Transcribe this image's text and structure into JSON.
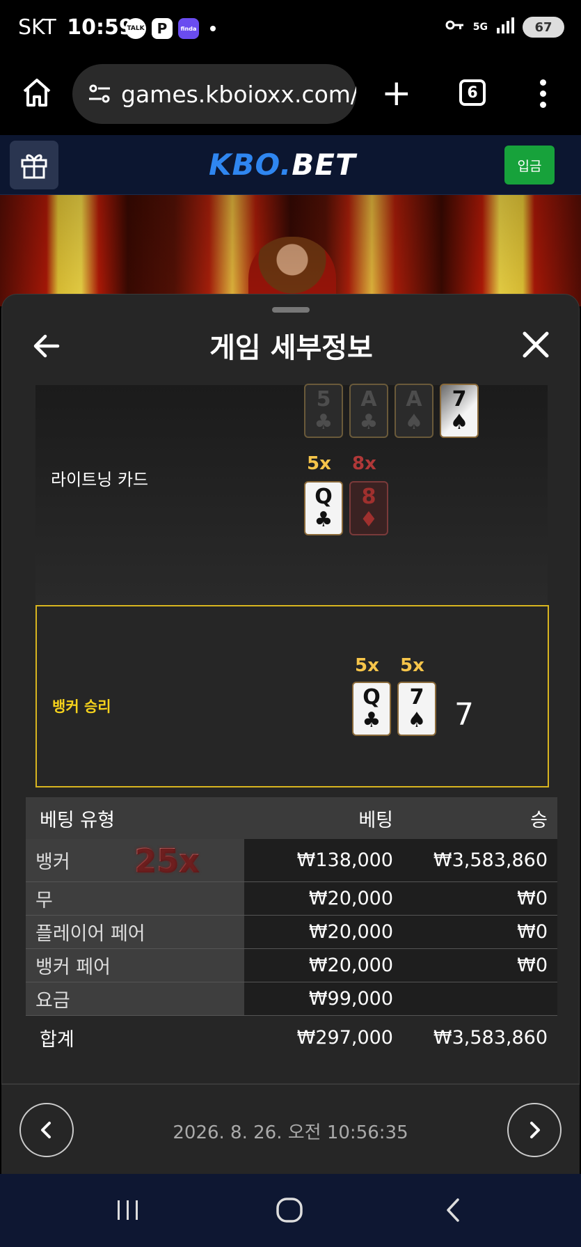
{
  "status_bar": {
    "carrier": "SKT",
    "time": "10:59",
    "apps": [
      "TALK",
      "P",
      "finda"
    ],
    "battery": "67",
    "network": "5G"
  },
  "browser": {
    "url": "games.kboioxx.com/",
    "tab_count": "6"
  },
  "site": {
    "logo_kbo": "KBO.",
    "logo_bet": "BET",
    "deposit_label": "입금"
  },
  "sheet": {
    "title": "게임 세부정보",
    "lightning_label": "라이트닝 카드",
    "top_cards": [
      {
        "rank": "5",
        "suit": "♣",
        "state": "dim"
      },
      {
        "rank": "A",
        "suit": "♣",
        "state": "dim"
      },
      {
        "rank": "A",
        "suit": "♠",
        "state": "dim"
      },
      {
        "rank": "7",
        "suit": "♠",
        "state": "lit"
      }
    ],
    "lightning_cards": [
      {
        "rank": "Q",
        "suit": "♣",
        "mult": "5x"
      },
      {
        "rank": "8",
        "suit": "♦",
        "mult": "8x"
      }
    ],
    "result_label": "뱅커 승리",
    "banker_cards": [
      {
        "rank": "Q",
        "suit": "♣",
        "mult": "5x"
      },
      {
        "rank": "7",
        "suit": "♠",
        "mult": "5x"
      }
    ],
    "banker_total": "7"
  },
  "bets": {
    "headers": {
      "type": "베팅 유형",
      "bet": "베팅",
      "win": "승"
    },
    "rows": [
      {
        "type": "뱅커",
        "mult": "25x",
        "bet": "₩138,000",
        "win": "₩3,583,860"
      },
      {
        "type": "무",
        "bet": "₩20,000",
        "win": "₩0"
      },
      {
        "type": "플레이어 페어",
        "bet": "₩20,000",
        "win": "₩0"
      },
      {
        "type": "뱅커 페어",
        "bet": "₩20,000",
        "win": "₩0"
      },
      {
        "type": "요금",
        "bet": "₩99,000",
        "win": ""
      }
    ],
    "total": {
      "type": "합계",
      "bet": "₩297,000",
      "win": "₩3,583,860"
    }
  },
  "footer": {
    "datetime": "2026. 8. 26. 오전 10:56:35"
  },
  "colors": {
    "accent_blue": "#2f86f0",
    "deposit_green": "#17a23b",
    "banker_gold": "#f5d21c",
    "mult_gold": "#f6c54a"
  }
}
